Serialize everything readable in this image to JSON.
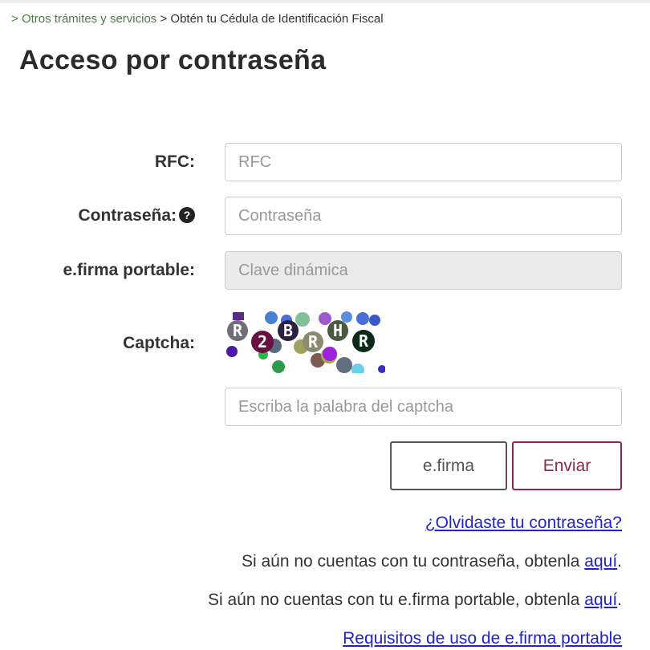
{
  "breadcrumb": {
    "separator": ">",
    "link": "Otros trámites y servicios",
    "current": "Obtén tu Cédula de Identificación Fiscal"
  },
  "title": "Acceso por contraseña",
  "form": {
    "rfc": {
      "label": "RFC:",
      "placeholder": "RFC",
      "value": ""
    },
    "password": {
      "label": "Contraseña:",
      "placeholder": "Contraseña",
      "value": "",
      "help_icon": "question-circle-icon"
    },
    "efirma_portable": {
      "label": "e.firma portable:",
      "placeholder": "Clave dinámica",
      "value": "",
      "disabled": true
    },
    "captcha": {
      "label": "Captcha:",
      "placeholder": "Escriba la palabra del captcha",
      "value": "",
      "characters": [
        "R",
        "2",
        "B",
        "R",
        "H",
        "R"
      ]
    }
  },
  "buttons": {
    "efirma": "e.firma",
    "enviar": "Enviar"
  },
  "links": {
    "forgot_password": "¿Olvidaste tu contraseña?",
    "no_password_text": "Si aún no cuentas con tu contraseña, obtenla ",
    "no_password_link": "aquí",
    "no_efirma_text": "Si aún no cuentas con tu e.firma portable, obtenla ",
    "no_efirma_link": "aquí",
    "requirements": "Requisitos de uso de e.firma portable",
    "period": "."
  },
  "colors": {
    "primary_button": "#8a2a44",
    "link": "#2222cc",
    "breadcrumb_link": "#4f7a49"
  }
}
